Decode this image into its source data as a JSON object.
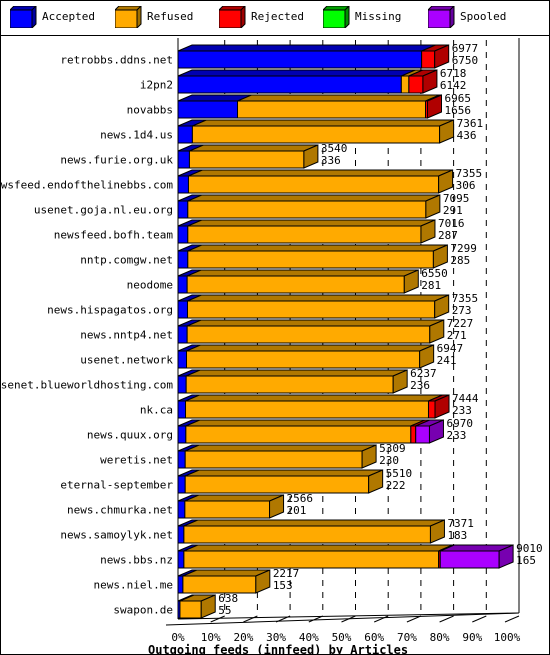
{
  "chart_data": {
    "type": "bar",
    "orientation": "horizontal",
    "stacked": true,
    "percent_stacked": true,
    "title": "Outgoing feeds (innfeed) by Articles",
    "xlabel": "Outgoing feeds (innfeed) by Articles",
    "ylabel": "",
    "xlim": [
      0,
      100
    ],
    "x_ticks": [
      "0%",
      "10%",
      "20%",
      "30%",
      "40%",
      "50%",
      "60%",
      "70%",
      "80%",
      "90%",
      "100%"
    ],
    "grid": true,
    "legend_position": "top",
    "legend": [
      {
        "name": "Accepted",
        "color": "#0000ff"
      },
      {
        "name": "Refused",
        "color": "#ffaa00"
      },
      {
        "name": "Rejected",
        "color": "#ff0000"
      },
      {
        "name": "Missing",
        "color": "#00ff00"
      },
      {
        "name": "Spooled",
        "color": "#aa00ff"
      }
    ],
    "categories": [
      "retrobbs.ddns.net",
      "i2pn2",
      "novabbs",
      "news.1d4.us",
      "news.furie.org.uk",
      "newsfeed.endofthelinebbs.com",
      "usenet.goja.nl.eu.org",
      "newsfeed.bofh.team",
      "nntp.comgw.net",
      "neodome",
      "news.hispagatos.org",
      "news.nntp4.net",
      "usenet.network",
      "usenet.blueworldhosting.com",
      "nk.ca",
      "news.quux.org",
      "weretis.net",
      "eternal-september",
      "news.chmurka.net",
      "news.samoylyk.net",
      "news.bbs.nz",
      "news.niel.me",
      "swapon.de"
    ],
    "total_labels": [
      6977,
      6718,
      6965,
      7361,
      3540,
      7355,
      7095,
      7016,
      7299,
      6550,
      7355,
      7227,
      6947,
      6237,
      7444,
      6970,
      5309,
      5510,
      2566,
      7371,
      9010,
      2217,
      638
    ],
    "second_labels": [
      6750,
      6142,
      1656,
      436,
      336,
      306,
      291,
      287,
      285,
      281,
      273,
      271,
      241,
      236,
      233,
      233,
      230,
      222,
      201,
      183,
      165,
      153,
      55
    ],
    "series": [
      {
        "name": "Accepted",
        "values": [
          74.5,
          68.3,
          18.2,
          4.4,
          3.5,
          3.2,
          3.0,
          3.0,
          3.0,
          2.8,
          2.9,
          2.8,
          2.6,
          2.5,
          2.3,
          2.4,
          2.2,
          2.2,
          2.1,
          1.8,
          1.8,
          1.5,
          0.6
        ]
      },
      {
        "name": "Refused",
        "values": [
          0,
          2.3,
          57.5,
          75.6,
          35.0,
          76.5,
          72.8,
          71.3,
          75.1,
          66.4,
          75.6,
          74.2,
          71.3,
          63.3,
          74.3,
          68.8,
          54.1,
          56.1,
          25.9,
          75.4,
          77.9,
          22.3,
          6.5
        ]
      },
      {
        "name": "Rejected",
        "values": [
          4.0,
          4.3,
          0.6,
          0,
          0,
          0,
          0,
          0,
          0,
          0,
          0,
          0,
          0,
          0,
          2.0,
          1.5,
          0,
          0,
          0,
          0,
          0.5,
          0,
          0
        ]
      },
      {
        "name": "Missing",
        "values": [
          0,
          0,
          0,
          0,
          0,
          0,
          0,
          0,
          0,
          0,
          0,
          0,
          0,
          0,
          0,
          0,
          0,
          0,
          0,
          0,
          0,
          0,
          0
        ]
      },
      {
        "name": "Spooled",
        "values": [
          0,
          0,
          0,
          0,
          0,
          0,
          0,
          0,
          0,
          0,
          0,
          0,
          0,
          0,
          0,
          4.2,
          0,
          0,
          0,
          0,
          18.0,
          0,
          0
        ]
      }
    ],
    "scale_max_total": 9010
  },
  "colors": {
    "accepted_front": "#0000ff",
    "accepted_top": "#0000b0",
    "refused_front": "#ffaa00",
    "refused_top": "#b07800",
    "rejected_front": "#ff0000",
    "rejected_top": "#b00000",
    "missing_front": "#00ff00",
    "missing_top": "#00a000",
    "spooled_front": "#aa00ff",
    "spooled_top": "#7700b0"
  }
}
